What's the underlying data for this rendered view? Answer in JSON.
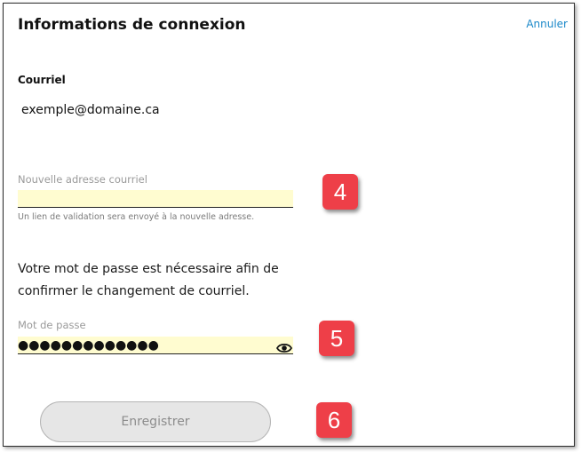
{
  "header": {
    "title": "Informations de connexion",
    "cancel_label": "Annuler"
  },
  "current_email": {
    "label": "Courriel",
    "value": "exemple@domaine.ca"
  },
  "new_email": {
    "label": "Nouvelle adresse courriel",
    "value": "",
    "hint": "Un lien de validation sera envoyé à la nouvelle adresse."
  },
  "password_notice": "Votre mot de passe est nécessaire afin de confirmer le changement de courriel.",
  "password": {
    "label": "Mot de passe",
    "masked_value": "●●●●●●●●●●●●●",
    "toggle_icon": "eye-icon"
  },
  "save_button": {
    "label": "Enregistrer"
  },
  "annotations": [
    {
      "number": "4",
      "color": "#ee3f48"
    },
    {
      "number": "5",
      "color": "#ee3f48"
    },
    {
      "number": "6",
      "color": "#ee3f48"
    }
  ],
  "colors": {
    "link": "#1a88c9",
    "input_bg": "#fffcd0",
    "badge": "#ee3f48"
  }
}
